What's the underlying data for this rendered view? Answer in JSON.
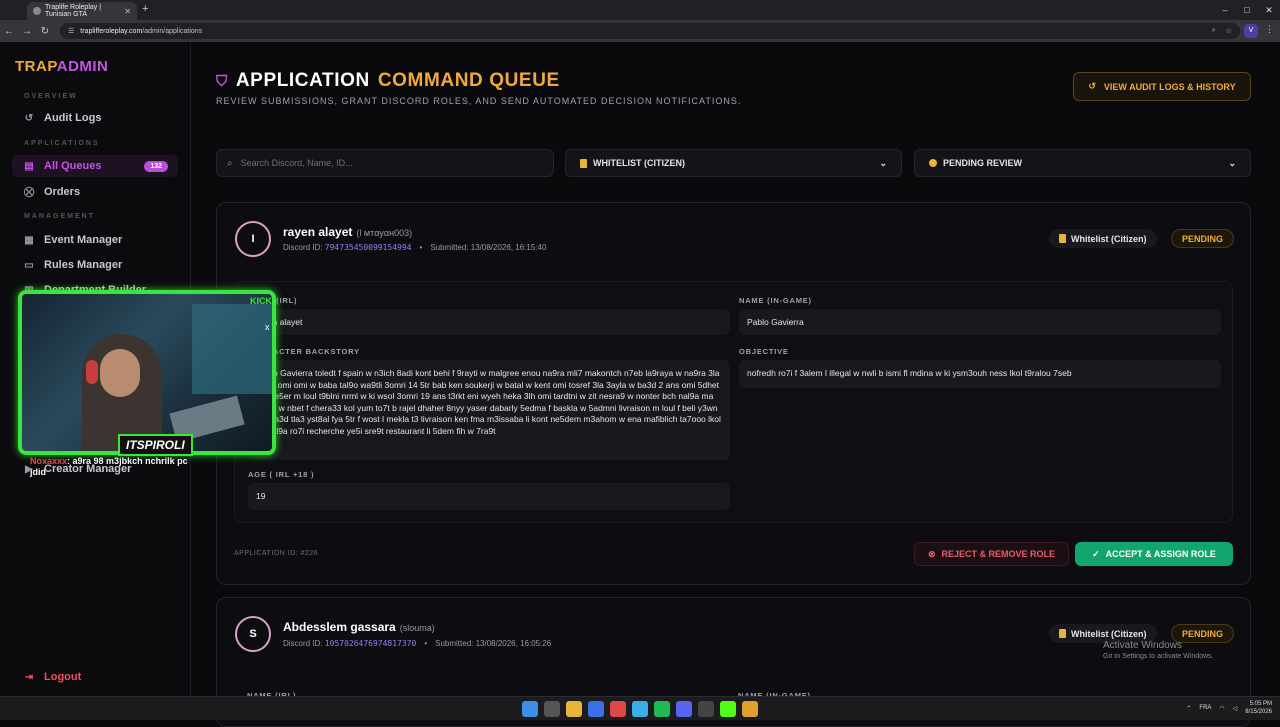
{
  "browser": {
    "tab_title": "Traplife Roleplay | Tunisian GTA",
    "url_host": "traplifferoleplay.com",
    "url_path": "/admin/applications",
    "profile_initial": "V"
  },
  "sidebar": {
    "brand_a": "TRAP",
    "brand_b": "ADMIN",
    "sections": {
      "overview": "OVERVIEW",
      "applications": "APPLICATIONS",
      "management": "MANAGEMENT"
    },
    "items": {
      "audit_logs": "Audit Logs",
      "all_queues": "All Queues",
      "all_queues_count": "132",
      "orders": "Orders",
      "event_manager": "Event Manager",
      "rules_manager": "Rules Manager",
      "department_builder": "Department Builder",
      "creator_manager": "Creator Manager",
      "logout": "Logout"
    }
  },
  "overlay": {
    "streamer": "ITSPIROLI",
    "kick": "KICK",
    "chat_user": "Noxaxxx",
    "chat_msg": ": a9ra 98 m3jbkch nchrilk pc jdid"
  },
  "header": {
    "title_a": "APPLICATION",
    "title_b": "COMMAND QUEUE",
    "subtitle": "REVIEW SUBMISSIONS, GRANT DISCORD ROLES, AND SEND AUTOMATED DECISION NOTIFICATIONS.",
    "audit_button": "VIEW AUDIT LOGS & HISTORY"
  },
  "filters": {
    "search_placeholder": "Search Discord, Name, ID...",
    "type_value": "WHITELIST (CITIZEN)",
    "status_value": "PENDING REVIEW"
  },
  "applications": [
    {
      "initial": "I",
      "name": "rayen alayet",
      "nick": "(l мтαуαн003)",
      "discord_label": "Discord ID:",
      "discord_id": "794735450099154994",
      "submitted": "Submitted: 13/08/2026, 16:15:40",
      "role_tag": "Whitelist (Citizen)",
      "status": "PENDING",
      "labels": {
        "name_irl": "NAME (IRL)",
        "name_ingame": "NAME (IN-GAME)",
        "backstory": "CHARACTER BACKSTORY",
        "objective": "OBJECTIVE",
        "age": "AGE ( IRL +18 )"
      },
      "name_irl": "rayen alayet",
      "name_ingame": "Pablo Gavierra",
      "backstory": "Pablo Gavierra toledt f spain w n3ich 8adi kont behi f 9rayti w malgree enou na9ra mli7 makontch n7eb la9raya w na9ra 3la 5ater omi omi w baba tal9o wa9tli 3omri 14 5tr bab ken soukerji w batal w kent omi tosref 3la 3ayla w ba3d 2 ans omi 5dhet rajel e5er m loul t9blni nrml w ki wsol 3omri 19 ans t3rkt eni wyeh heka 3lh omi tardtni w zit nesra9 w nonter bch nal9a ma nekel w nbet f chera33 kol yum to7t b rajel dhaher 8nyy yaser dabarly 5edma f baskla w 5admni livraison m loul f beli y3wn fya ba3d tla3 yst8al fya 5tr f wost l mekla t3 livraison ken fma m3issaba li kont ne5dem m3ahom w ena mafiblich ta7ooo lkol lin nal9a ro7i recherche ye5i sre9t restaurant li 5dem fih w 7ra9t",
      "objective": "nofredh ro7i f 3alem l illegal w nwli b ismi fl mdina w ki ysm3ouh ness lkol t9ralou 7seb",
      "age": "19",
      "app_id": "APPLICATION ID: #226",
      "reject_label": "REJECT & REMOVE ROLE",
      "accept_label": "ACCEPT & ASSIGN ROLE"
    },
    {
      "initial": "S",
      "name": "Abdesslem gassara",
      "nick": "(slouma)",
      "discord_label": "Discord ID:",
      "discord_id": "1057026476974817370",
      "submitted": "Submitted: 13/08/2026, 16:05:26",
      "role_tag": "Whitelist (Citizen)",
      "status": "PENDING",
      "labels": {
        "name_irl": "NAME (IRL)",
        "name_ingame": "NAME (IN-GAME)"
      }
    }
  ],
  "os": {
    "watermark_title": "Activate Windows",
    "watermark_sub": "Go to Settings to activate Windows.",
    "lang": "FRA",
    "time": "5:05 PM",
    "date": "8/15/2026"
  },
  "colors": {
    "accent_orange": "#f2a93b",
    "accent_purple": "#c653e6",
    "accept_green": "#13a56e",
    "reject_red": "#e85c6a"
  }
}
